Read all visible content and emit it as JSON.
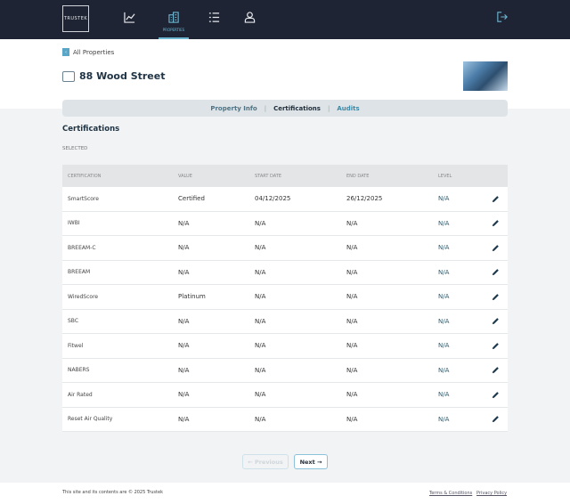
{
  "header": {
    "logo": "TRUSTEK",
    "nav": [
      {
        "name": "analytics",
        "label": ""
      },
      {
        "name": "properties",
        "label": "PROPERTIES"
      },
      {
        "name": "list",
        "label": ""
      },
      {
        "name": "user",
        "label": ""
      }
    ]
  },
  "back_label": "All Properties",
  "property": {
    "title": "88 Wood Street"
  },
  "tabs": [
    "Property Info",
    "Certifications",
    "Audits"
  ],
  "section_title": "Certifications",
  "selected_label": "SELECTED",
  "table": {
    "headers": [
      "CERTIFICATION",
      "VALUE",
      "START DATE",
      "END DATE",
      "LEVEL"
    ],
    "rows": [
      [
        "SmartScore",
        "Certified",
        "04/12/2025",
        "26/12/2025",
        "N/A"
      ],
      [
        "IWBI",
        "N/A",
        "N/A",
        "N/A",
        "N/A"
      ],
      [
        "BREEAM-C",
        "N/A",
        "N/A",
        "N/A",
        "N/A"
      ],
      [
        "BREEAM",
        "N/A",
        "N/A",
        "N/A",
        "N/A"
      ],
      [
        "WiredScore",
        "Platinum",
        "N/A",
        "N/A",
        "N/A"
      ],
      [
        "SBC",
        "N/A",
        "N/A",
        "N/A",
        "N/A"
      ],
      [
        "Fitwel",
        "N/A",
        "N/A",
        "N/A",
        "N/A"
      ],
      [
        "NABERS",
        "N/A",
        "N/A",
        "N/A",
        "N/A"
      ],
      [
        "Air Rated",
        "N/A",
        "N/A",
        "N/A",
        "N/A"
      ],
      [
        "Reset Air Quality",
        "N/A",
        "N/A",
        "N/A",
        "N/A"
      ]
    ]
  },
  "pagination": {
    "previous": "← Previous",
    "next": "Next →"
  },
  "footer": {
    "copyright": "This site and its contents are © 2025 Trustek",
    "terms": "Terms & Conditions",
    "privacy": "Privacy Policy"
  }
}
